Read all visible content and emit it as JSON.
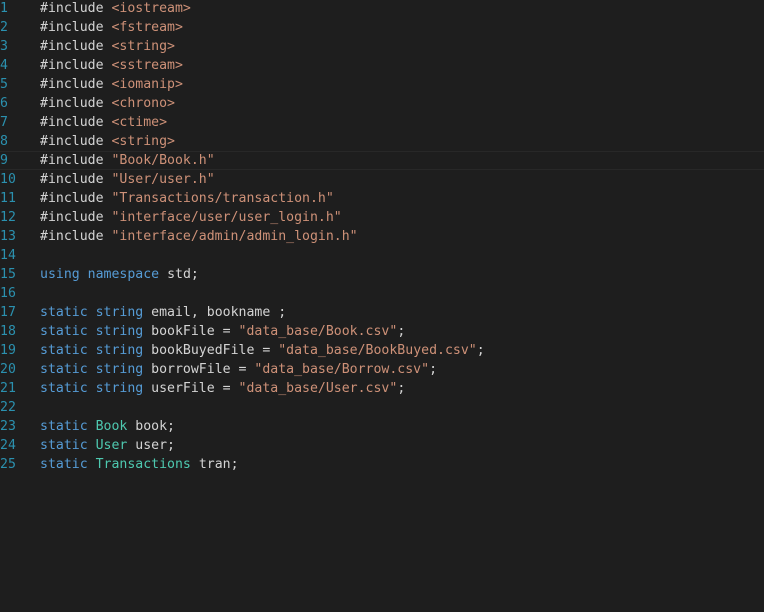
{
  "editor": {
    "colors": {
      "background": "#1e1e1e",
      "line_number": "#2b91af",
      "text": "#d4d4d4",
      "keyword": "#569cd6",
      "type": "#4ec9b0",
      "string": "#ce9178"
    },
    "current_line": 9,
    "lines": [
      {
        "n": "1",
        "tokens": [
          [
            "pp",
            "#include "
          ],
          [
            "str",
            "<iostream>"
          ]
        ]
      },
      {
        "n": "2",
        "tokens": [
          [
            "pp",
            "#include "
          ],
          [
            "str",
            "<fstream>"
          ]
        ]
      },
      {
        "n": "3",
        "tokens": [
          [
            "pp",
            "#include "
          ],
          [
            "str",
            "<string>"
          ]
        ]
      },
      {
        "n": "4",
        "tokens": [
          [
            "pp",
            "#include "
          ],
          [
            "str",
            "<sstream>"
          ]
        ]
      },
      {
        "n": "5",
        "tokens": [
          [
            "pp",
            "#include "
          ],
          [
            "str",
            "<iomanip>"
          ]
        ]
      },
      {
        "n": "6",
        "tokens": [
          [
            "pp",
            "#include "
          ],
          [
            "str",
            "<chrono>"
          ]
        ]
      },
      {
        "n": "7",
        "tokens": [
          [
            "pp",
            "#include "
          ],
          [
            "str",
            "<ctime>"
          ]
        ]
      },
      {
        "n": "8",
        "tokens": [
          [
            "pp",
            "#include "
          ],
          [
            "str",
            "<string>"
          ]
        ]
      },
      {
        "n": "9",
        "tokens": [
          [
            "pp",
            "#include "
          ],
          [
            "str",
            "\"Book/Book.h\""
          ]
        ]
      },
      {
        "n": "10",
        "tokens": [
          [
            "pp",
            "#include "
          ],
          [
            "str",
            "\"User/user.h\""
          ]
        ]
      },
      {
        "n": "11",
        "tokens": [
          [
            "pp",
            "#include "
          ],
          [
            "str",
            "\"Transactions/transaction.h\""
          ]
        ]
      },
      {
        "n": "12",
        "tokens": [
          [
            "pp",
            "#include "
          ],
          [
            "str",
            "\"interface/user/user_login.h\""
          ]
        ]
      },
      {
        "n": "13",
        "tokens": [
          [
            "pp",
            "#include "
          ],
          [
            "str",
            "\"interface/admin/admin_login.h\""
          ]
        ]
      },
      {
        "n": "14",
        "tokens": []
      },
      {
        "n": "15",
        "tokens": [
          [
            "kw",
            "using"
          ],
          [
            "id",
            " "
          ],
          [
            "kw",
            "namespace"
          ],
          [
            "id",
            " std;"
          ]
        ]
      },
      {
        "n": "16",
        "tokens": []
      },
      {
        "n": "17",
        "tokens": [
          [
            "kw",
            "static"
          ],
          [
            "id",
            " "
          ],
          [
            "kw",
            "string"
          ],
          [
            "id",
            " email, bookname ;"
          ]
        ]
      },
      {
        "n": "18",
        "tokens": [
          [
            "kw",
            "static"
          ],
          [
            "id",
            " "
          ],
          [
            "kw",
            "string"
          ],
          [
            "id",
            " bookFile = "
          ],
          [
            "str",
            "\"data_base/Book.csv\""
          ],
          [
            "id",
            ";"
          ]
        ]
      },
      {
        "n": "19",
        "tokens": [
          [
            "kw",
            "static"
          ],
          [
            "id",
            " "
          ],
          [
            "kw",
            "string"
          ],
          [
            "id",
            " bookBuyedFile = "
          ],
          [
            "str",
            "\"data_base/BookBuyed.csv\""
          ],
          [
            "id",
            ";"
          ]
        ]
      },
      {
        "n": "20",
        "tokens": [
          [
            "kw",
            "static"
          ],
          [
            "id",
            " "
          ],
          [
            "kw",
            "string"
          ],
          [
            "id",
            " borrowFile = "
          ],
          [
            "str",
            "\"data_base/Borrow.csv\""
          ],
          [
            "id",
            ";"
          ]
        ]
      },
      {
        "n": "21",
        "tokens": [
          [
            "kw",
            "static"
          ],
          [
            "id",
            " "
          ],
          [
            "kw",
            "string"
          ],
          [
            "id",
            " userFile = "
          ],
          [
            "str",
            "\"data_base/User.csv\""
          ],
          [
            "id",
            ";"
          ]
        ]
      },
      {
        "n": "22",
        "tokens": []
      },
      {
        "n": "23",
        "tokens": [
          [
            "kw",
            "static"
          ],
          [
            "id",
            " "
          ],
          [
            "ty",
            "Book"
          ],
          [
            "id",
            " book;"
          ]
        ]
      },
      {
        "n": "24",
        "tokens": [
          [
            "kw",
            "static"
          ],
          [
            "id",
            " "
          ],
          [
            "ty",
            "User"
          ],
          [
            "id",
            " user;"
          ]
        ]
      },
      {
        "n": "25",
        "tokens": [
          [
            "kw",
            "static"
          ],
          [
            "id",
            " "
          ],
          [
            "ty",
            "Transactions"
          ],
          [
            "id",
            " tran;"
          ]
        ]
      }
    ]
  }
}
